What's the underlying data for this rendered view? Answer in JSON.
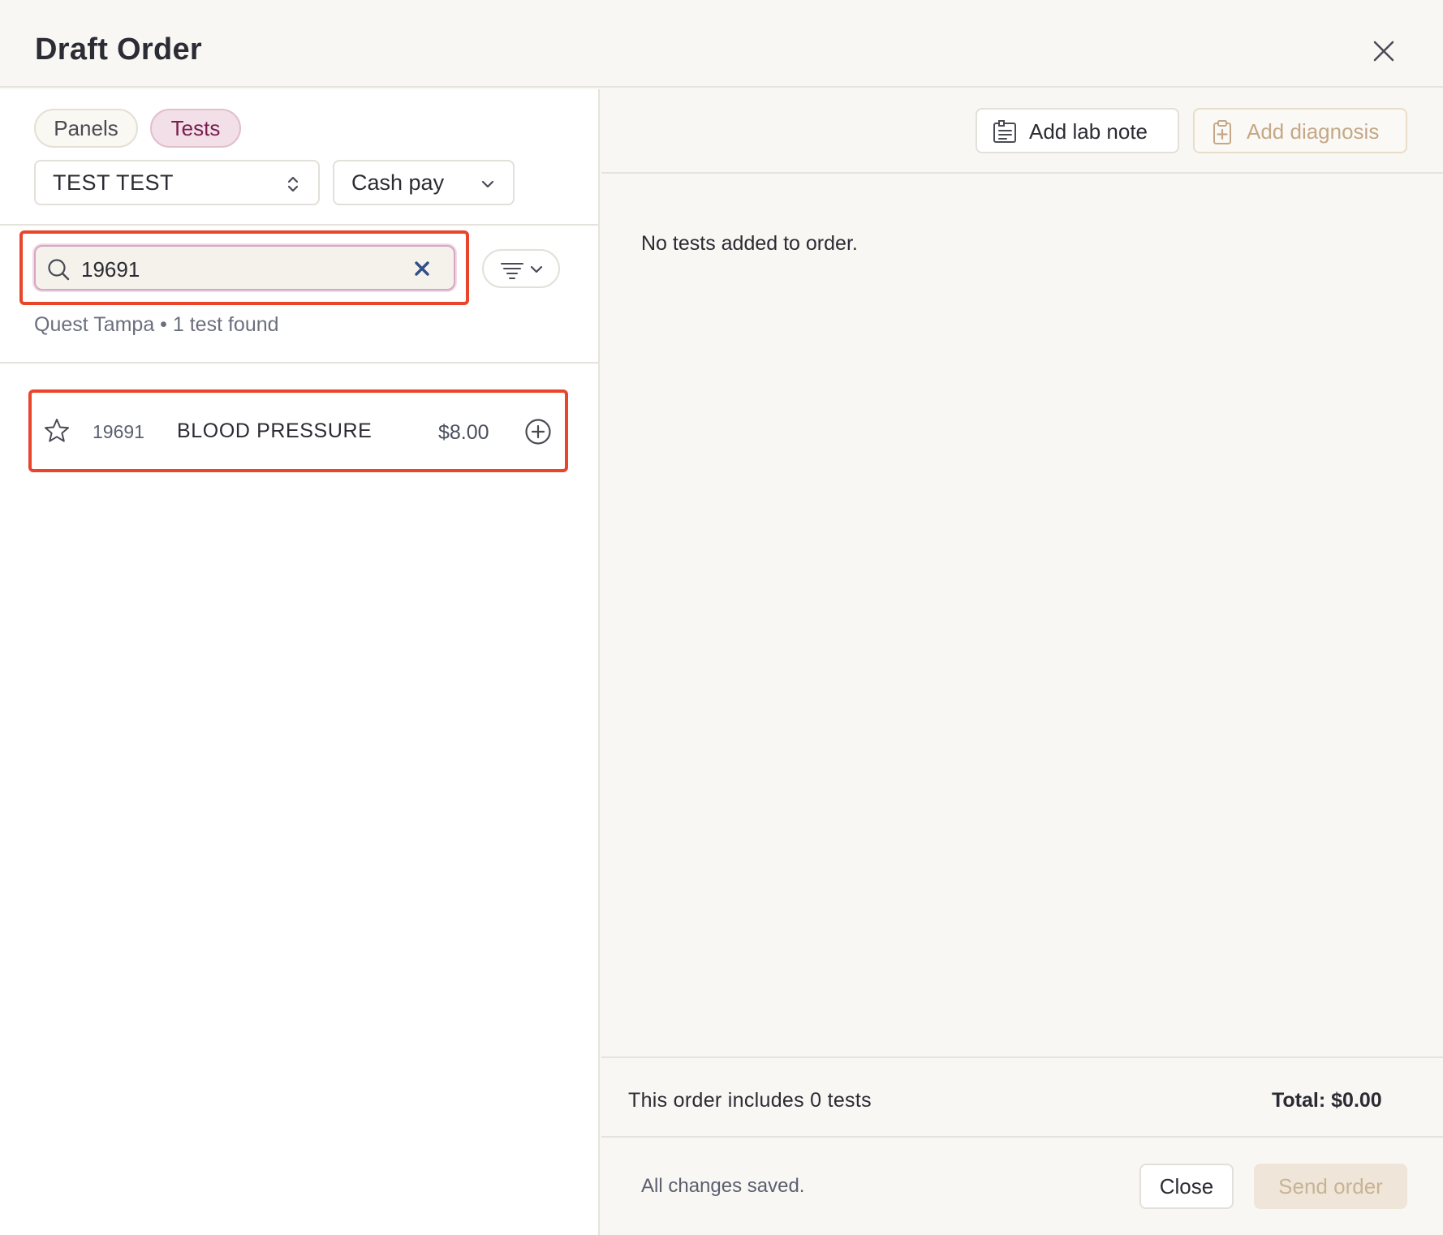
{
  "header": {
    "title": "Draft Order"
  },
  "tabs": {
    "panels": "Panels",
    "tests": "Tests"
  },
  "patient_select": {
    "value": "TEST TEST"
  },
  "payment_select": {
    "value": "Cash pay"
  },
  "search": {
    "value": "19691"
  },
  "results": {
    "summary": "Quest Tampa • 1 test found",
    "items": [
      {
        "code": "19691",
        "name": "BLOOD PRESSURE",
        "price": "$8.00"
      }
    ]
  },
  "toolbar": {
    "add_lab_note": "Add lab note",
    "add_diagnosis": "Add diagnosis"
  },
  "order": {
    "empty_message": "No tests added to order.",
    "summary": "This order includes 0 tests",
    "total": "Total: $0.00"
  },
  "footer": {
    "status": "All changes saved.",
    "close_label": "Close",
    "send_label": "Send order"
  },
  "colors": {
    "accent": "#7a1e4e",
    "highlight": "#e8452a",
    "background": "#f8f7f4"
  },
  "icons": [
    "close-icon",
    "chevron-updown-icon",
    "chevron-down-icon",
    "search-icon",
    "clear-icon",
    "filter-icon",
    "star-icon",
    "add-circle-icon",
    "lab-note-icon",
    "clipboard-plus-icon"
  ]
}
